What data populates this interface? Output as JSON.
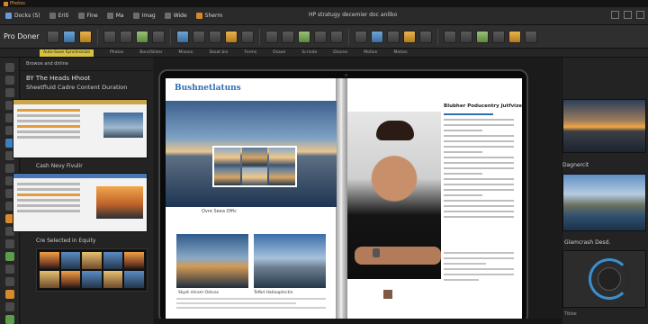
{
  "app": {
    "title": "Photos"
  },
  "menubar": {
    "items": [
      {
        "label": "Docks (S)",
        "color": "#6c9ad0"
      },
      {
        "label": "Eriti",
        "color": "#9a9a9a"
      },
      {
        "label": "Fine",
        "color": "#9a9a9a"
      },
      {
        "label": "Ma",
        "color": "#9a9a9a"
      },
      {
        "label": "Imag",
        "color": "#9a9a9a"
      },
      {
        "label": "Wide",
        "color": "#9a9a9a"
      },
      {
        "label": "Sherm",
        "color": "#d9852b"
      }
    ],
    "document_title": "HP stratugy decemier doc anlibo"
  },
  "toolbar": {
    "label": "Pro Doner"
  },
  "optbar": {
    "active": "Auto-Save Synchronize",
    "items": [
      "Photos",
      "Boro/Slides",
      "Mixoon",
      "Skoat bin",
      "Forms",
      "Osaoe",
      "Scrinde",
      "Dianne",
      "Motion",
      "Motion"
    ]
  },
  "leftpanel": {
    "header": "Browoe and dirline",
    "heading": "BY The Heads Hhoot",
    "subheading": "Sheetfluid Cadre Content Duration",
    "caption1": "Cash Nevy Fivulir",
    "caption2": "Cre Selected in Equity"
  },
  "magazine": {
    "title": "Bushnetlatuns",
    "city_caption": "Ovre Seea Offic",
    "pic_a_caption": "Skyst nhrom Ostvos",
    "pic_b_caption": "Tefbd Hatioaptsctin",
    "article_title": "Blubher Poducentry Jutfvize"
  },
  "rightpanel": {
    "label1": "Dagnercit",
    "label2": "Glamcrash Desd.",
    "footer": "Tibbe"
  },
  "colors": {
    "accent": "#d58a2b",
    "link": "#2f6fb3",
    "active_tab": "#d7c240"
  }
}
